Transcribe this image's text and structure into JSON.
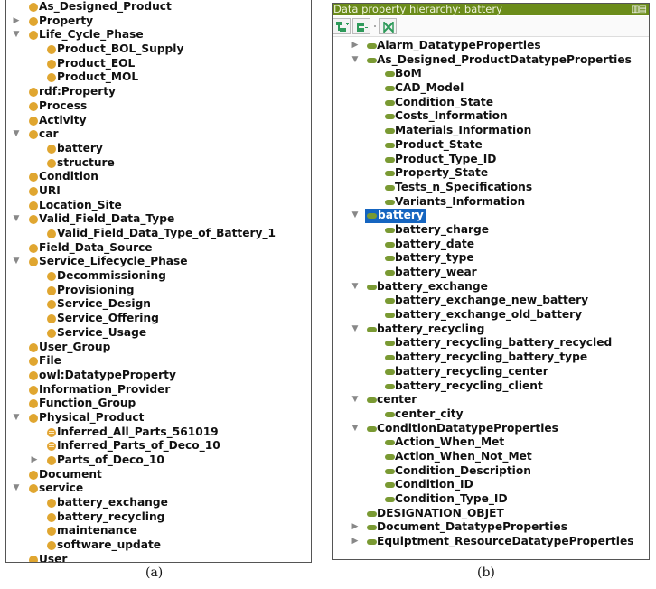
{
  "panel_a": {
    "caption": "(a)",
    "items": [
      {
        "label": "As_Designed_Product",
        "depth": 0,
        "toggle": "",
        "icon": "class"
      },
      {
        "label": "Property",
        "depth": 0,
        "toggle": "▶",
        "icon": "class"
      },
      {
        "label": "Life_Cycle_Phase",
        "depth": 0,
        "toggle": "▼",
        "icon": "class"
      },
      {
        "label": "Product_BOL_Supply",
        "depth": 1,
        "toggle": "",
        "icon": "class"
      },
      {
        "label": "Product_EOL",
        "depth": 1,
        "toggle": "",
        "icon": "class"
      },
      {
        "label": "Product_MOL",
        "depth": 1,
        "toggle": "",
        "icon": "class"
      },
      {
        "label": "rdf:Property",
        "depth": 0,
        "toggle": "",
        "icon": "class"
      },
      {
        "label": "Process",
        "depth": 0,
        "toggle": "",
        "icon": "class"
      },
      {
        "label": "Activity",
        "depth": 0,
        "toggle": "",
        "icon": "class"
      },
      {
        "label": "car",
        "depth": 0,
        "toggle": "▼",
        "icon": "class"
      },
      {
        "label": "battery",
        "depth": 1,
        "toggle": "",
        "icon": "class"
      },
      {
        "label": "structure",
        "depth": 1,
        "toggle": "",
        "icon": "class"
      },
      {
        "label": "Condition",
        "depth": 0,
        "toggle": "",
        "icon": "class"
      },
      {
        "label": "URI",
        "depth": 0,
        "toggle": "",
        "icon": "class"
      },
      {
        "label": "Location_Site",
        "depth": 0,
        "toggle": "",
        "icon": "class"
      },
      {
        "label": "Valid_Field_Data_Type",
        "depth": 0,
        "toggle": "▼",
        "icon": "class"
      },
      {
        "label": "Valid_Field_Data_Type_of_Battery_1",
        "depth": 1,
        "toggle": "",
        "icon": "class"
      },
      {
        "label": "Field_Data_Source",
        "depth": 0,
        "toggle": "",
        "icon": "class"
      },
      {
        "label": "Service_Lifecycle_Phase",
        "depth": 0,
        "toggle": "▼",
        "icon": "class"
      },
      {
        "label": "Decommissioning",
        "depth": 1,
        "toggle": "",
        "icon": "class"
      },
      {
        "label": "Provisioning",
        "depth": 1,
        "toggle": "",
        "icon": "class"
      },
      {
        "label": "Service_Design",
        "depth": 1,
        "toggle": "",
        "icon": "class"
      },
      {
        "label": "Service_Offering",
        "depth": 1,
        "toggle": "",
        "icon": "class"
      },
      {
        "label": "Service_Usage",
        "depth": 1,
        "toggle": "",
        "icon": "class"
      },
      {
        "label": "User_Group",
        "depth": 0,
        "toggle": "",
        "icon": "class"
      },
      {
        "label": "File",
        "depth": 0,
        "toggle": "",
        "icon": "class"
      },
      {
        "label": "owl:DatatypeProperty",
        "depth": 0,
        "toggle": "",
        "icon": "class"
      },
      {
        "label": "Information_Provider",
        "depth": 0,
        "toggle": "",
        "icon": "class"
      },
      {
        "label": "Function_Group",
        "depth": 0,
        "toggle": "",
        "icon": "class"
      },
      {
        "label": "Physical_Product",
        "depth": 0,
        "toggle": "▼",
        "icon": "class"
      },
      {
        "label": "Inferred_All_Parts_561019",
        "depth": 1,
        "toggle": "",
        "icon": "inferred-class"
      },
      {
        "label": "Inferred_Parts_of_Deco_10",
        "depth": 1,
        "toggle": "",
        "icon": "inferred-class"
      },
      {
        "label": "Parts_of_Deco_10",
        "depth": 1,
        "toggle": "▶",
        "icon": "class"
      },
      {
        "label": "Document",
        "depth": 0,
        "toggle": "",
        "icon": "class"
      },
      {
        "label": "service",
        "depth": 0,
        "toggle": "▼",
        "icon": "class"
      },
      {
        "label": "battery_exchange",
        "depth": 1,
        "toggle": "",
        "icon": "class"
      },
      {
        "label": "battery_recycling",
        "depth": 1,
        "toggle": "",
        "icon": "class"
      },
      {
        "label": "maintenance",
        "depth": 1,
        "toggle": "",
        "icon": "class"
      },
      {
        "label": "software_update",
        "depth": 1,
        "toggle": "",
        "icon": "class"
      },
      {
        "label": "User",
        "depth": 0,
        "toggle": "",
        "icon": "class"
      }
    ]
  },
  "panel_b": {
    "caption": "(b)",
    "title": "Data property hierarchy: battery",
    "window_icons": "▥▤",
    "toolbar": [
      {
        "name": "add-sub-property-button",
        "icon": "add-sub-property-icon"
      },
      {
        "name": "add-sibling-property-button",
        "icon": "add-sibling-property-icon"
      },
      {
        "name": "delete-property-button",
        "icon": "delete-property-icon"
      }
    ],
    "selected": "battery",
    "items": [
      {
        "label": "Alarm_DatatypeProperties",
        "depth": 0,
        "toggle": "▶"
      },
      {
        "label": "As_Designed_ProductDatatypeProperties",
        "depth": 0,
        "toggle": "▼"
      },
      {
        "label": "BoM",
        "depth": 1,
        "toggle": ""
      },
      {
        "label": "CAD_Model",
        "depth": 1,
        "toggle": ""
      },
      {
        "label": "Condition_State",
        "depth": 1,
        "toggle": ""
      },
      {
        "label": "Costs_Information",
        "depth": 1,
        "toggle": ""
      },
      {
        "label": "Materials_Information",
        "depth": 1,
        "toggle": ""
      },
      {
        "label": "Product_State",
        "depth": 1,
        "toggle": ""
      },
      {
        "label": "Product_Type_ID",
        "depth": 1,
        "toggle": ""
      },
      {
        "label": "Property_State",
        "depth": 1,
        "toggle": ""
      },
      {
        "label": "Tests_n_Specifications",
        "depth": 1,
        "toggle": ""
      },
      {
        "label": "Variants_Information",
        "depth": 1,
        "toggle": ""
      },
      {
        "label": "battery",
        "depth": 0,
        "toggle": "▼",
        "selected": true
      },
      {
        "label": "battery_charge",
        "depth": 1,
        "toggle": ""
      },
      {
        "label": "battery_date",
        "depth": 1,
        "toggle": ""
      },
      {
        "label": "battery_type",
        "depth": 1,
        "toggle": ""
      },
      {
        "label": "battery_wear",
        "depth": 1,
        "toggle": ""
      },
      {
        "label": "battery_exchange",
        "depth": 0,
        "toggle": "▼"
      },
      {
        "label": "battery_exchange_new_battery",
        "depth": 1,
        "toggle": ""
      },
      {
        "label": "battery_exchange_old_battery",
        "depth": 1,
        "toggle": ""
      },
      {
        "label": "battery_recycling",
        "depth": 0,
        "toggle": "▼"
      },
      {
        "label": "battery_recycling_battery_recycled",
        "depth": 1,
        "toggle": ""
      },
      {
        "label": "battery_recycling_battery_type",
        "depth": 1,
        "toggle": ""
      },
      {
        "label": "battery_recycling_center",
        "depth": 1,
        "toggle": ""
      },
      {
        "label": "battery_recycling_client",
        "depth": 1,
        "toggle": ""
      },
      {
        "label": "center",
        "depth": 0,
        "toggle": "▼"
      },
      {
        "label": "center_city",
        "depth": 1,
        "toggle": ""
      },
      {
        "label": "ConditionDatatypeProperties",
        "depth": 0,
        "toggle": "▼"
      },
      {
        "label": "Action_When_Met",
        "depth": 1,
        "toggle": ""
      },
      {
        "label": "Action_When_Not_Met",
        "depth": 1,
        "toggle": ""
      },
      {
        "label": "Condition_Description",
        "depth": 1,
        "toggle": ""
      },
      {
        "label": "Condition_ID",
        "depth": 1,
        "toggle": ""
      },
      {
        "label": "Condition_Type_ID",
        "depth": 1,
        "toggle": ""
      },
      {
        "label": "DESIGNATION_OBJET",
        "depth": 0,
        "toggle": ""
      },
      {
        "label": "Document_DatatypeProperties",
        "depth": 0,
        "toggle": "▶"
      },
      {
        "label": "Equiptment_ResourceDatatypeProperties",
        "depth": 0,
        "toggle": "▶"
      }
    ]
  },
  "colors": {
    "class_icon": "#e0a630",
    "property_icon": "#7a9a33",
    "title_bar": "#6b8c1a",
    "selection": "#1565c0",
    "toolbar_icon": "#2e9a5a"
  }
}
